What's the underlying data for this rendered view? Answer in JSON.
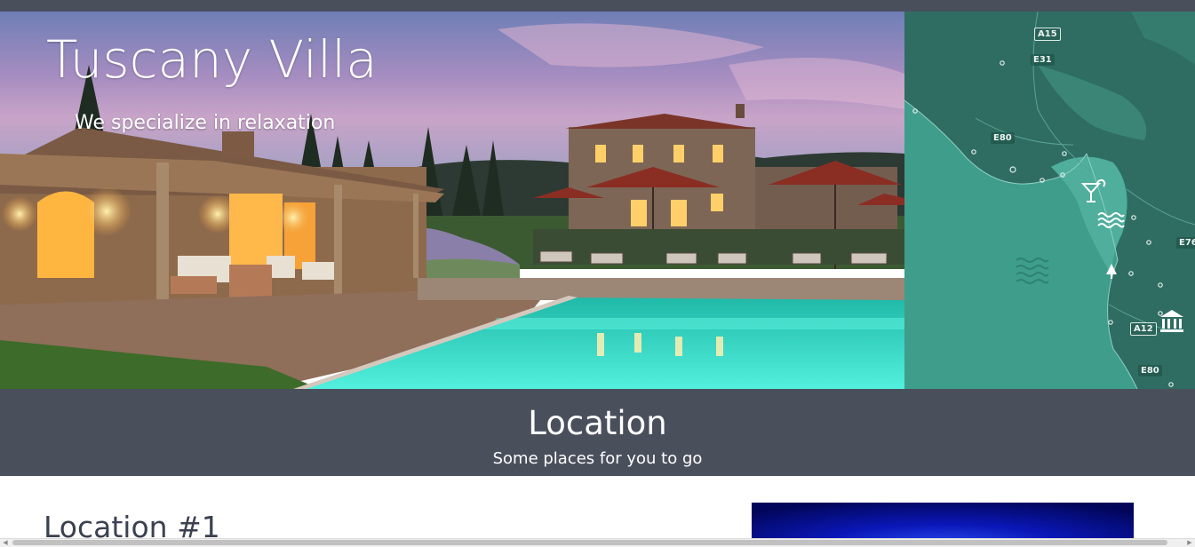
{
  "hero": {
    "title": "Tuscany Villa",
    "tagline": "We specialize in relaxation"
  },
  "map": {
    "road_labels": [
      "A15",
      "E31",
      "E80",
      "E76",
      "A12",
      "E80"
    ],
    "icons": [
      "cocktail-icon",
      "waves-icon",
      "waves-icon",
      "tree-icon",
      "museum-icon"
    ]
  },
  "location_section": {
    "title": "Location",
    "subtitle": "Some places for you to go"
  },
  "locations": [
    {
      "heading": "Location #1"
    }
  ],
  "colors": {
    "band": "#4a4f5c",
    "sea": "#3d9b8b",
    "land": "#2f6d62",
    "pool": "#38e6cf",
    "heading_text": "#3b4150"
  }
}
